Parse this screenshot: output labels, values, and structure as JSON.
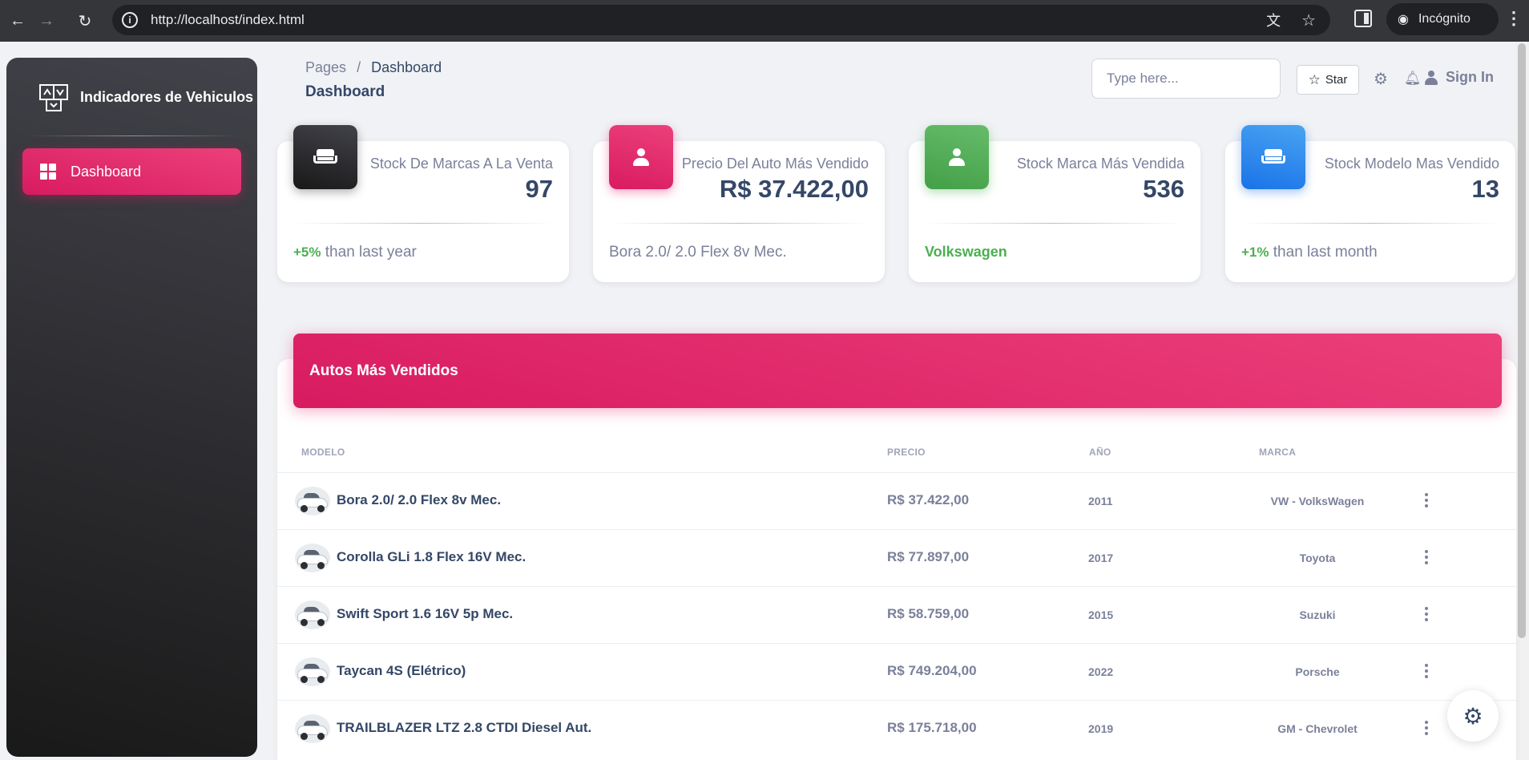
{
  "browser": {
    "url": "http://localhost/index.html",
    "profile_label": "Incógnito"
  },
  "sidebar": {
    "brand": "Indicadores de Vehiculos",
    "items": [
      {
        "label": "Dashboard",
        "icon": "dashboard-icon",
        "active": true
      }
    ]
  },
  "topnav": {
    "breadcrumb_parent": "Pages",
    "breadcrumb_sep": "/",
    "breadcrumb_current": "Dashboard",
    "title": "Dashboard",
    "search_placeholder": "Type here...",
    "star_label": "Star",
    "signin_label": "Sign In"
  },
  "cards": [
    {
      "title": "Stock De Marcas A La Venta",
      "value": "97",
      "foot_highlight": "+5%",
      "foot_text": " than last year",
      "icon": "sofa-icon",
      "icon_color": "#1a1a1a"
    },
    {
      "title": "Precio Del Auto Más Vendido",
      "value": "R$ 37.422,00",
      "foot_highlight": "",
      "foot_text": "Bora 2.0/ 2.0 Flex 8v Mec.",
      "icon": "person-icon",
      "icon_color": "#e91e63"
    },
    {
      "title": "Stock Marca Más Vendida",
      "value": "536",
      "foot_highlight": "",
      "foot_text": "Volkswagen",
      "icon": "person-icon",
      "icon_color": "#4caf50"
    },
    {
      "title": "Stock Modelo Mas Vendido",
      "value": "13",
      "foot_highlight": "+1%",
      "foot_text": " than last month",
      "icon": "sofa-icon",
      "icon_color": "#1a73e8"
    }
  ],
  "table": {
    "title": "Autos Más Vendidos",
    "columns": [
      "MODELO",
      "PRECIO",
      "AÑO",
      "MARCA"
    ],
    "rows": [
      {
        "model": "Bora 2.0/ 2.0 Flex 8v Mec.",
        "price": "R$ 37.422,00",
        "year": "2011",
        "brand": "VW - VolksWagen"
      },
      {
        "model": "Corolla GLi 1.8 Flex 16V Mec.",
        "price": "R$ 77.897,00",
        "year": "2017",
        "brand": "Toyota"
      },
      {
        "model": "Swift Sport 1.6 16V 5p Mec.",
        "price": "R$ 58.759,00",
        "year": "2015",
        "brand": "Suzuki"
      },
      {
        "model": "Taycan 4S (Elétrico)",
        "price": "R$ 749.204,00",
        "year": "2022",
        "brand": "Porsche"
      },
      {
        "model": "TRAILBLAZER LTZ 2.8 CTDI Diesel Aut.",
        "price": "R$ 175.718,00",
        "year": "2019",
        "brand": "GM - Chevrolet"
      }
    ]
  },
  "colors": {
    "accent": "#e91e63",
    "sidebar_dark": "#191919",
    "text_dark": "#344767",
    "text_muted": "#7b809a",
    "success": "#4caf50"
  }
}
